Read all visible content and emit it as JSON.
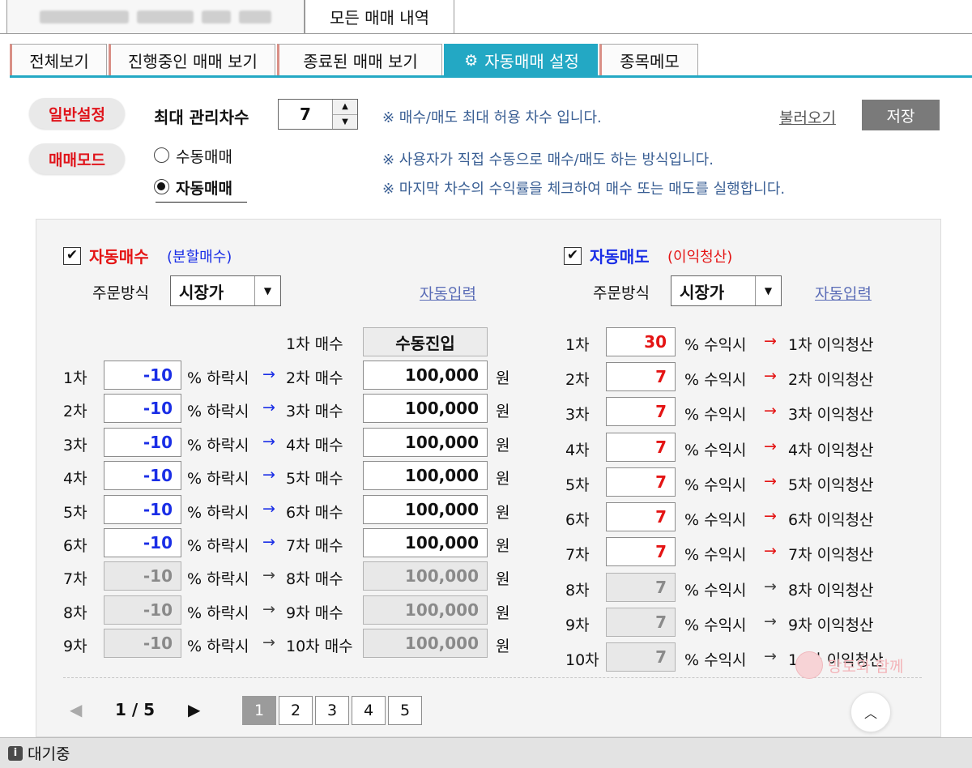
{
  "top_tabs": [
    {
      "label": ""
    },
    {
      "label": "모든 매매 내역"
    }
  ],
  "sub_tabs": [
    {
      "label": "전체보기"
    },
    {
      "label": "진행중인 매매 보기"
    },
    {
      "label": "종료된 매매 보기"
    },
    {
      "label": "자동매매 설정",
      "icon": "gear-icon",
      "active": true
    },
    {
      "label": "종목메모"
    }
  ],
  "settings": {
    "general_badge": "일반설정",
    "max_label": "최대 관리차수",
    "max_value": "7",
    "max_note": "※ 매수/매도 최대 허용 차수 입니다.",
    "load_label": "불러오기",
    "save_label": "저장",
    "mode_badge": "매매모드",
    "mode_options": [
      {
        "label": "수동매매",
        "selected": false,
        "note": "※ 사용자가 직접 수동으로 매수/매도 하는 방식입니다."
      },
      {
        "label": "자동매매",
        "selected": true,
        "note": "※ 마지막 차수의 수익률을 체크하여 매수 또는 매도를 실행합니다."
      }
    ]
  },
  "buy": {
    "checked": true,
    "title": "자동매수",
    "subtitle": "(분할매수)",
    "order_label": "주문방식",
    "order_type": "시장가",
    "auto_input": "자동입력",
    "first_label": "1차 매수",
    "first_value": "수동진입",
    "rows": [
      {
        "step": "1차",
        "pct": "-10",
        "cond": "% 하락시",
        "target": "2차 매수",
        "amount": "100,000",
        "unit": "원",
        "enabled": true
      },
      {
        "step": "2차",
        "pct": "-10",
        "cond": "% 하락시",
        "target": "3차 매수",
        "amount": "100,000",
        "unit": "원",
        "enabled": true
      },
      {
        "step": "3차",
        "pct": "-10",
        "cond": "% 하락시",
        "target": "4차 매수",
        "amount": "100,000",
        "unit": "원",
        "enabled": true
      },
      {
        "step": "4차",
        "pct": "-10",
        "cond": "% 하락시",
        "target": "5차 매수",
        "amount": "100,000",
        "unit": "원",
        "enabled": true
      },
      {
        "step": "5차",
        "pct": "-10",
        "cond": "% 하락시",
        "target": "6차 매수",
        "amount": "100,000",
        "unit": "원",
        "enabled": true
      },
      {
        "step": "6차",
        "pct": "-10",
        "cond": "% 하락시",
        "target": "7차 매수",
        "amount": "100,000",
        "unit": "원",
        "enabled": true
      },
      {
        "step": "7차",
        "pct": "-10",
        "cond": "% 하락시",
        "target": "8차 매수",
        "amount": "100,000",
        "unit": "원",
        "enabled": false
      },
      {
        "step": "8차",
        "pct": "-10",
        "cond": "% 하락시",
        "target": "9차 매수",
        "amount": "100,000",
        "unit": "원",
        "enabled": false
      },
      {
        "step": "9차",
        "pct": "-10",
        "cond": "% 하락시",
        "target": "10차 매수",
        "amount": "100,000",
        "unit": "원",
        "enabled": false
      }
    ]
  },
  "sell": {
    "checked": true,
    "title": "자동매도",
    "subtitle": "(이익청산)",
    "order_label": "주문방식",
    "order_type": "시장가",
    "auto_input": "자동입력",
    "rows": [
      {
        "step": "1차",
        "pct": "30",
        "cond": "% 수익시",
        "target": "1차 이익청산",
        "enabled": true
      },
      {
        "step": "2차",
        "pct": "7",
        "cond": "% 수익시",
        "target": "2차 이익청산",
        "enabled": true
      },
      {
        "step": "3차",
        "pct": "7",
        "cond": "% 수익시",
        "target": "3차 이익청산",
        "enabled": true
      },
      {
        "step": "4차",
        "pct": "7",
        "cond": "% 수익시",
        "target": "4차 이익청산",
        "enabled": true
      },
      {
        "step": "5차",
        "pct": "7",
        "cond": "% 수익시",
        "target": "5차 이익청산",
        "enabled": true
      },
      {
        "step": "6차",
        "pct": "7",
        "cond": "% 수익시",
        "target": "6차 이익청산",
        "enabled": true
      },
      {
        "step": "7차",
        "pct": "7",
        "cond": "% 수익시",
        "target": "7차 이익청산",
        "enabled": true
      },
      {
        "step": "8차",
        "pct": "7",
        "cond": "% 수익시",
        "target": "8차 이익청산",
        "enabled": false
      },
      {
        "step": "9차",
        "pct": "7",
        "cond": "% 수익시",
        "target": "9차 이익청산",
        "enabled": false
      },
      {
        "step": "10차",
        "pct": "7",
        "cond": "% 수익시",
        "target": "10차 이익청산",
        "enabled": false
      }
    ]
  },
  "pagination": {
    "prev": "◀",
    "current": "1 / 5",
    "next": "▶",
    "pages": [
      "1",
      "2",
      "3",
      "4",
      "5"
    ],
    "active_page": "1",
    "up": "︿"
  },
  "watermark": "망토와 함께",
  "status": {
    "icon": "info-icon",
    "text": "대기중"
  },
  "colors": {
    "accent": "#23a8c4",
    "buy_value": "#1a2ee6",
    "sell_value": "#e41414",
    "badge_text": "#e0141b"
  }
}
